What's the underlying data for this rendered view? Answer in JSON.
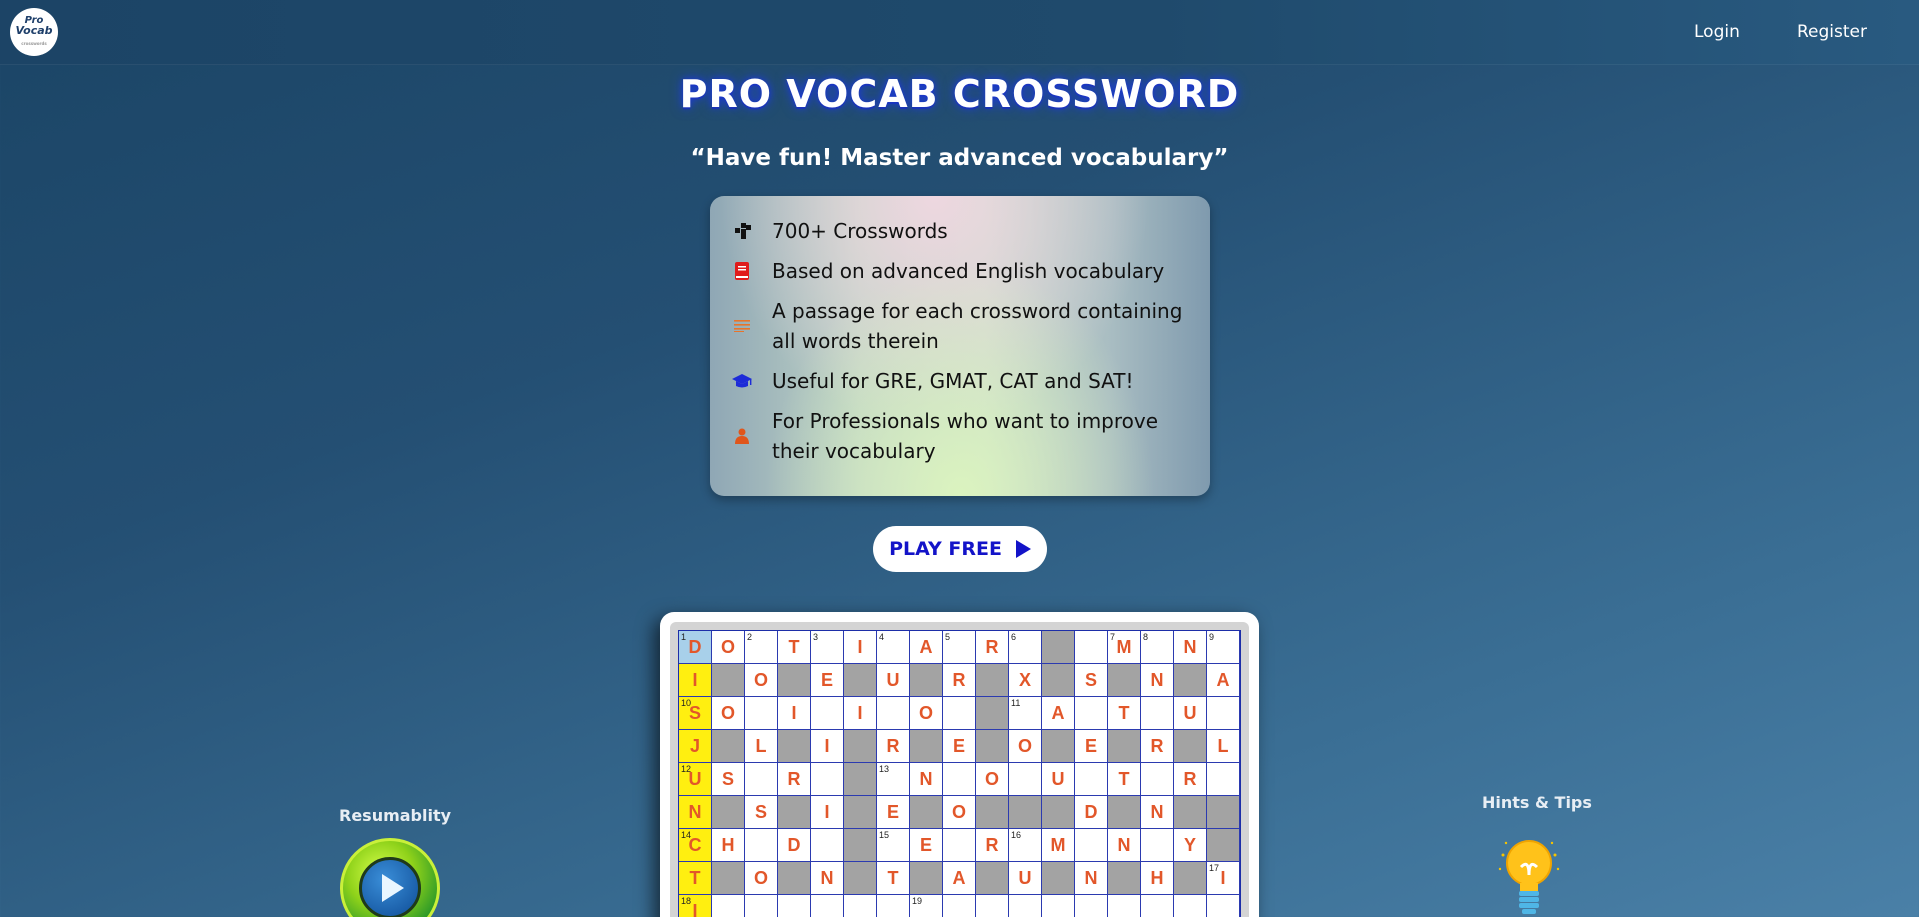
{
  "header": {
    "logo": {
      "line1": "Pro",
      "line2": "Vocab",
      "line3": "crosswords"
    },
    "login_label": "Login",
    "register_label": "Register"
  },
  "hero": {
    "title": "PRO VOCAB CROSSWORD",
    "tagline": "“Have fun! Master advanced vocabulary”"
  },
  "features": [
    {
      "icon": "grid-blocks-icon",
      "text": "700+ Crosswords",
      "color": "#111111"
    },
    {
      "icon": "book-icon",
      "text": "Based on advanced English vocabulary",
      "color": "#e01b1b"
    },
    {
      "icon": "text-lines-icon",
      "text": "A passage for each crossword containing all words therein",
      "color": "#e8742a"
    },
    {
      "icon": "graduation-cap-icon",
      "text": "Useful for GRE, GMAT, CAT and SAT!",
      "color": "#1d2bd8"
    },
    {
      "icon": "professional-user-icon",
      "text": "For Professionals who want to improve their vocabulary",
      "color": "#e0561b"
    }
  ],
  "cta": {
    "label": "PLAY FREE"
  },
  "side": {
    "resumability_label": "Resumablity",
    "hints_label": "Hints & Tips"
  },
  "crossword": {
    "rows": [
      [
        "D",
        "O",
        "",
        "T",
        "",
        "I",
        "",
        "A",
        "",
        "R",
        "",
        "#",
        "",
        "M",
        "",
        "N",
        ""
      ],
      [
        "I",
        "#",
        "O",
        "#",
        "E",
        "#",
        "U",
        "#",
        "R",
        "#",
        "X",
        "#",
        "S",
        "#",
        "N",
        "#",
        "A"
      ],
      [
        "S",
        "O",
        "",
        "I",
        "",
        "I",
        "",
        "O",
        "",
        "#",
        "",
        "A",
        "",
        "T",
        "",
        "U",
        ""
      ],
      [
        "J",
        "#",
        "L",
        "#",
        "I",
        "#",
        "R",
        "#",
        "E",
        "#",
        "O",
        "#",
        "E",
        "#",
        "R",
        "#",
        "L"
      ],
      [
        "U",
        "S",
        "",
        "R",
        "",
        "#",
        "",
        "N",
        "",
        "O",
        "",
        "U",
        "",
        "T",
        "",
        "R",
        ""
      ],
      [
        "N",
        "#",
        "S",
        "#",
        "I",
        "#",
        "E",
        "#",
        "O",
        "#",
        "#",
        "#",
        "D",
        "#",
        "N",
        "#",
        "#"
      ],
      [
        "C",
        "H",
        "",
        "D",
        "",
        "#",
        "",
        "E",
        "",
        "R",
        "",
        "M",
        "",
        "N",
        "",
        "Y",
        "#"
      ],
      [
        "T",
        "#",
        "O",
        "#",
        "N",
        "#",
        "T",
        "#",
        "A",
        "#",
        "U",
        "#",
        "N",
        "#",
        "H",
        "#",
        "I"
      ],
      [
        "I",
        "",
        "",
        "",
        "",
        "",
        "",
        "",
        "",
        "",
        "",
        "",
        "",
        "",
        "",
        "",
        ""
      ]
    ],
    "numbers": [
      [
        "1",
        "",
        "2",
        "",
        "3",
        "",
        "4",
        "",
        "5",
        "",
        "6",
        "",
        "",
        "7",
        "8",
        "",
        "9"
      ],
      [
        "",
        "",
        "",
        "",
        "",
        "",
        "",
        "",
        "",
        "",
        "",
        "",
        "",
        "",
        "",
        "",
        ""
      ],
      [
        "10",
        "",
        "",
        "",
        "",
        "",
        "",
        "",
        "",
        "",
        "11",
        "",
        "",
        "",
        "",
        "",
        ""
      ],
      [
        "",
        "",
        "",
        "",
        "",
        "",
        "",
        "",
        "",
        "",
        "",
        "",
        "",
        "",
        "",
        "",
        ""
      ],
      [
        "12",
        "",
        "",
        "",
        "",
        "",
        "13",
        "",
        "",
        "",
        "",
        "",
        "",
        "",
        "",
        "",
        ""
      ],
      [
        "",
        "",
        "",
        "",
        "",
        "",
        "",
        "",
        "",
        "",
        "",
        "",
        "",
        "",
        "",
        "",
        ""
      ],
      [
        "14",
        "",
        "",
        "",
        "",
        "",
        "15",
        "",
        "",
        "",
        "16",
        "",
        "",
        "",
        "",
        "",
        ""
      ],
      [
        "",
        "",
        "",
        "",
        "",
        "",
        "",
        "",
        "",
        "",
        "",
        "",
        "",
        "",
        "",
        "",
        "17"
      ],
      [
        "18",
        "",
        "",
        "",
        "",
        "",
        "",
        "19",
        "",
        "",
        "",
        "",
        "",
        "",
        "",
        "",
        ""
      ]
    ],
    "highlight_column": 0,
    "selected_cell": [
      0,
      0
    ]
  }
}
